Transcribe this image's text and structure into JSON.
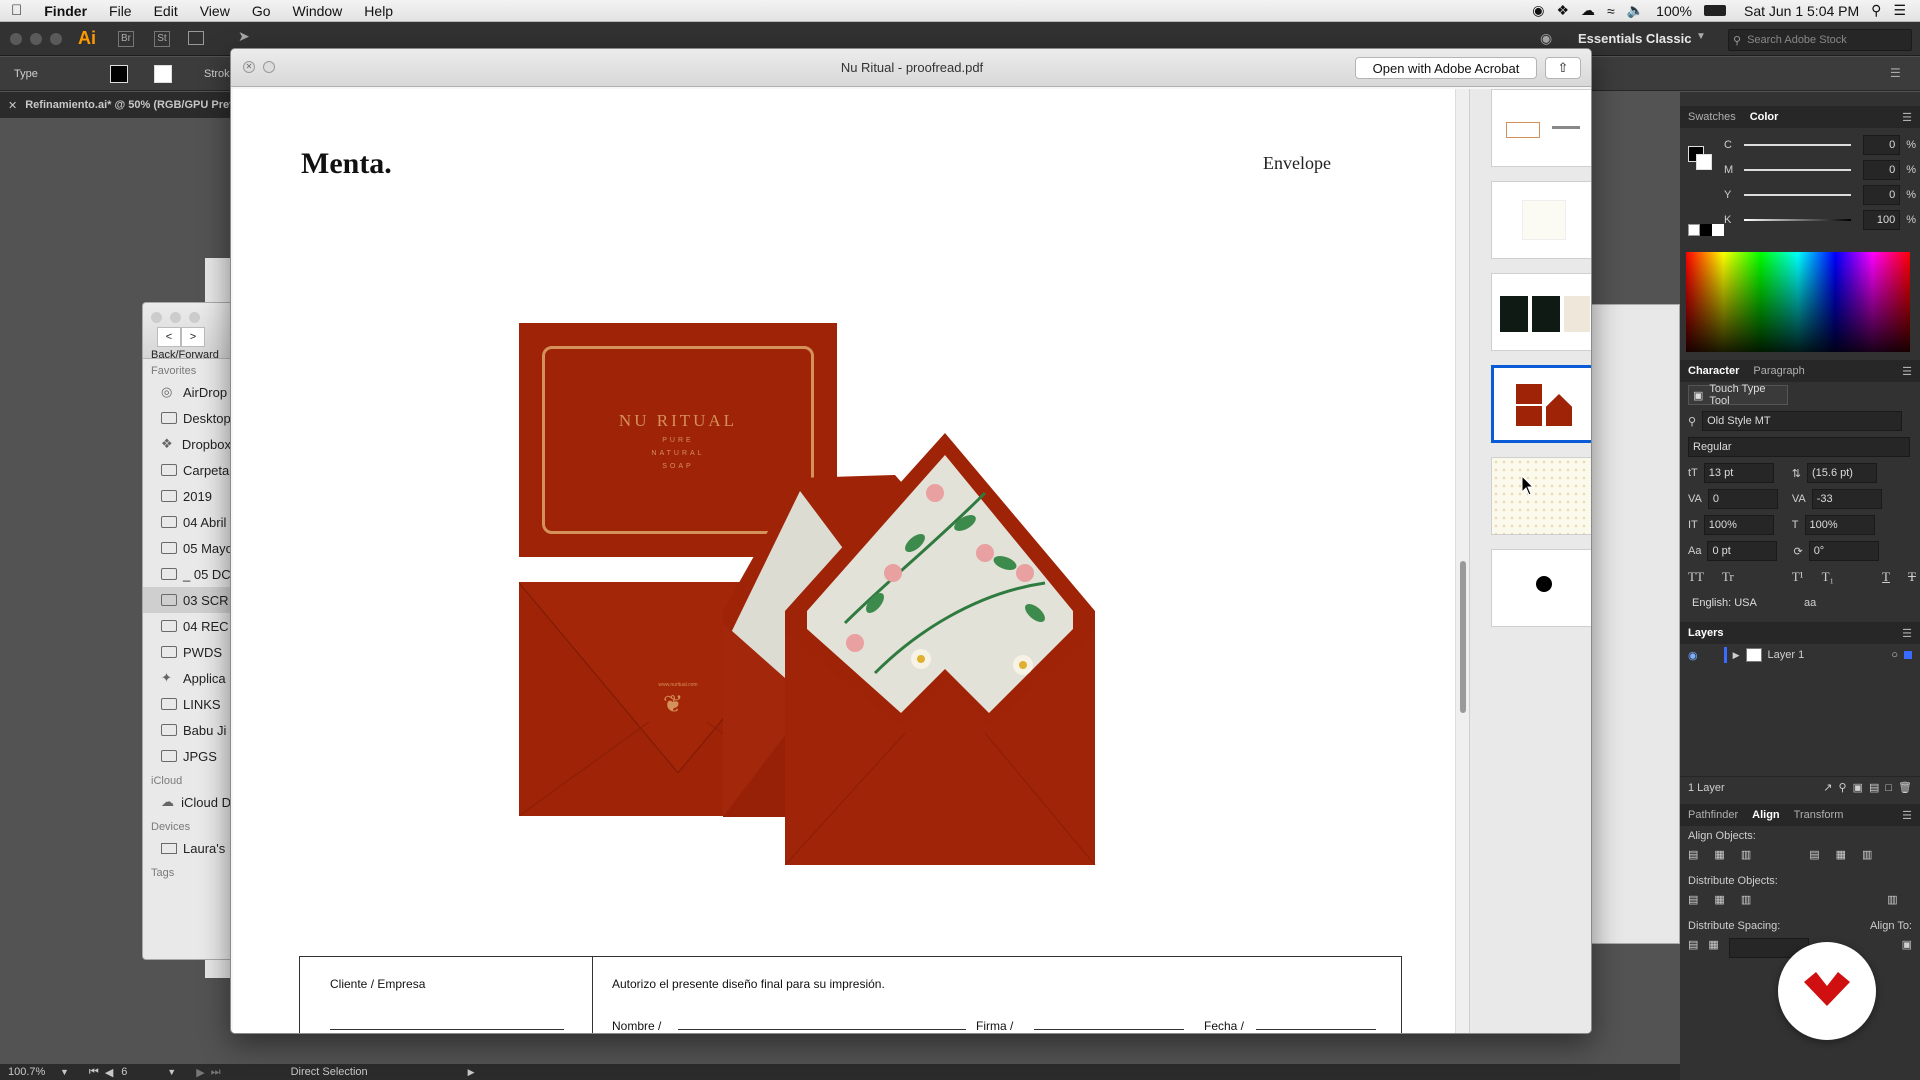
{
  "menubar": {
    "app": "Finder",
    "items": [
      "File",
      "Edit",
      "View",
      "Go",
      "Window",
      "Help"
    ],
    "battery": "100%",
    "datetime": "Sat Jun 1  5:04 PM"
  },
  "illustrator": {
    "logo": "Ai",
    "workspace": "Essentials Classic",
    "stock_search_placeholder": "Search Adobe Stock",
    "control_label_type": "Type",
    "control_label_stroke": "Strok",
    "doc_tab": "Refinamiento.ai* @ 50% (RGB/GPU Previ",
    "status": {
      "zoom": "100.7%",
      "page": "6",
      "tool": "Direct Selection"
    }
  },
  "color_panel": {
    "tabs": [
      "Swatches",
      "Color"
    ],
    "channels": [
      {
        "label": "C",
        "value": "0"
      },
      {
        "label": "M",
        "value": "0"
      },
      {
        "label": "Y",
        "value": "0"
      },
      {
        "label": "K",
        "value": "100"
      }
    ],
    "unit": "%"
  },
  "character_panel": {
    "tabs": [
      "Character",
      "Paragraph"
    ],
    "touch_tool": "Touch Type Tool",
    "font": "Old Style MT",
    "style": "Regular",
    "size": "13 pt",
    "leading": "(15.6 pt)",
    "kerning": "0",
    "tracking": "-33",
    "vscale": "100%",
    "hscale": "100%",
    "baseline": "0 pt",
    "rotation": "0°",
    "language": "English: USA",
    "type_buttons": [
      "TT",
      "Tr",
      "T¹",
      "T₁",
      "T",
      "T"
    ]
  },
  "layers_panel": {
    "title": "Layers",
    "layer_name": "Layer 1",
    "count": "1 Layer"
  },
  "align_panel": {
    "tabs": [
      "Pathfinder",
      "Align",
      "Transform"
    ],
    "align_objects": "Align Objects:",
    "distribute_objects": "Distribute Objects:",
    "distribute_spacing": "Distribute Spacing:",
    "align_to": "Align To:"
  },
  "finder": {
    "back_forward": "Back/Forward",
    "favorites_header": "Favorites",
    "favorites": [
      "AirDrop",
      "Desktop",
      "Dropbox",
      "Carpeta",
      "2019",
      "04 Abril",
      "05 Mayo",
      "_ 05 DC",
      "03 SCR",
      "04 REC",
      "PWDS",
      "Applica",
      "LINKS",
      "Babu Ji",
      "JPGS"
    ],
    "selected_index": 8,
    "icloud_header": "iCloud",
    "icloud": [
      "iCloud D"
    ],
    "devices_header": "Devices",
    "devices": [
      "Laura's"
    ],
    "tags_header": "Tags"
  },
  "preview": {
    "title": "Nu Ritual - proofread.pdf",
    "open_button": "Open with Adobe Acrobat",
    "selected_thumb_index": 3,
    "page": {
      "brand": "Menta.",
      "section": "Envelope",
      "card_brand": "NU RITUAL",
      "card_sub": [
        "PURE",
        "NATURAL",
        "SOAP"
      ],
      "seal_text": "www.nuritual.com",
      "form": {
        "client": "Cliente / Empresa",
        "authorize": "Autorizo el presente diseño final para su impresión.",
        "name": "Nombre /",
        "signature": "Firma /",
        "date": "Fecha /"
      }
    }
  },
  "colors": {
    "envelope_red": "#9e2307",
    "gold_foil": "#d4915a",
    "selection_blue": "#0a5bd6",
    "ai_dark": "#323232"
  }
}
